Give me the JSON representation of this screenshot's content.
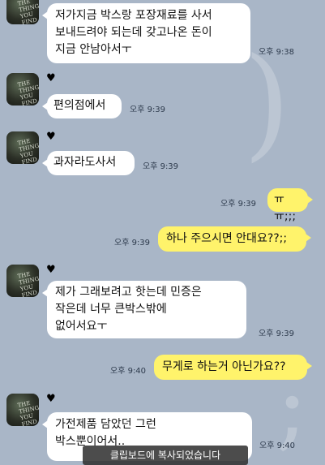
{
  "watermarks": [
    ")",
    ",",
    ";"
  ],
  "avatar": {
    "image_label": "the-thing-album-art",
    "caption_lines": [
      "THE THING",
      "YOU FIND"
    ]
  },
  "heart_glyph": "♥",
  "messages": [
    {
      "side": "left",
      "text": "저가지금 박스랑 포장재료를 사서\n보내드려야 되는데 갖고나온 돈이\n지금 안남아서ㅜ",
      "time": "오후 9:38"
    },
    {
      "side": "left",
      "text": "편의점에서",
      "time": "오후 9:39"
    },
    {
      "side": "left",
      "text": "과자라도사서",
      "time": "오후 9:39"
    },
    {
      "side": "right",
      "text": "ㅠㅠ;;;",
      "time": "오후 9:39"
    },
    {
      "side": "right",
      "text": "하나 주으시면 안대요??;;",
      "time": "오후 9:39"
    },
    {
      "side": "left",
      "text": "제가 그래보려고 핫는데 민증은\n작은데 너무 큰박스밖에\n없어서요ㅜ",
      "time": "오후 9:39"
    },
    {
      "side": "right",
      "text": "무게로 하는거 아닌가요??",
      "time": "오후 9:40"
    },
    {
      "side": "left",
      "text": "가전제품 담았던 그런\n박스뿐이어서..",
      "time": "오후 9:40"
    }
  ],
  "toast": "클립보드에 복사되었습니다"
}
